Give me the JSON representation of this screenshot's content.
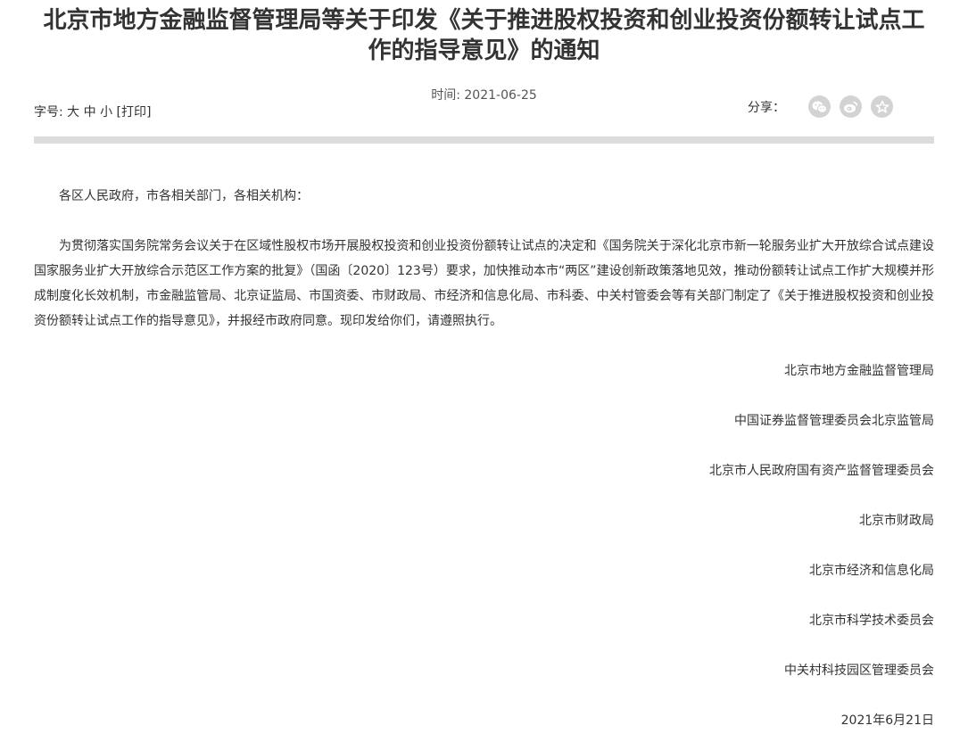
{
  "title": "北京市地方金融监督管理局等关于印发《关于推进股权投资和创业投资份额转让试点工作的指导意见》的通知",
  "meta": {
    "time_label": "时间: 2021-06-25",
    "font_label": "字号:",
    "font_large": "大",
    "font_medium": "中",
    "font_small": "小",
    "print": "[打印]",
    "share_label": "分享："
  },
  "share_icons": [
    "wechat-icon",
    "weibo-icon",
    "favorite-star-icon"
  ],
  "content": {
    "salutation": "各区人民政府，市各相关部门，各相关机构：",
    "paragraph": "为贯彻落实国务院常务会议关于在区域性股权市场开展股权投资和创业投资份额转让试点的决定和《国务院关于深化北京市新一轮服务业扩大开放综合试点建设国家服务业扩大开放综合示范区工作方案的批复》（国函〔2020〕123号）要求，加快推动本市“两区”建设创新政策落地见效，推动份额转让试点工作扩大规模并形成制度化长效机制，市金融监管局、北京证监局、市国资委、市财政局、市经济和信息化局、市科委、中关村管委会等有关部门制定了《关于推进股权投资和创业投资份额转让试点工作的指导意见》，并报经市政府同意。现印发给你们，请遵照执行。",
    "signatures": [
      "北京市地方金融监督管理局",
      "中国证券监督管理委员会北京监管局",
      "北京市人民政府国有资产监督管理委员会",
      "北京市财政局",
      "北京市经济和信息化局",
      "北京市科学技术委员会",
      "中关村科技园区管理委员会",
      "2021年6月21日"
    ]
  }
}
